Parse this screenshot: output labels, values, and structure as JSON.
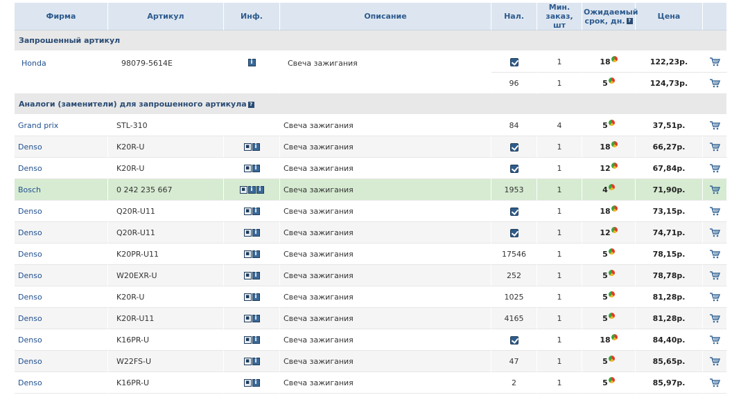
{
  "header": {
    "firm": "Фирма",
    "article": "Артикул",
    "info": "Инф.",
    "description": "Описание",
    "stock": "Нал.",
    "min_order_1": "Мин.",
    "min_order_2": "заказ, шт",
    "eta_1": "Ожидаемый",
    "eta_2": "срок, дн.",
    "price": "Цена"
  },
  "section_requested": "Запрошенный артикул",
  "section_analogs": "Аналоги (заменители) для запрошенного артикула",
  "requested": {
    "firm": "Honda",
    "article": "98079-5614E",
    "description": "Свеча зажигания",
    "offers": [
      {
        "stock": "check",
        "min": "1",
        "eta": "18",
        "price": "122,23р."
      },
      {
        "stock": "96",
        "min": "1",
        "eta": "5",
        "price": "124,73р."
      }
    ]
  },
  "analogs": [
    {
      "firm": "Grand prix",
      "article": "STL-310",
      "info": "",
      "description": "Свеча зажигания",
      "stock": "84",
      "min": "4",
      "eta": "5",
      "price": "37,51р."
    },
    {
      "firm": "Denso",
      "article": "K20R-U",
      "info": "pi",
      "description": "Свеча зажигания",
      "stock": "check",
      "min": "1",
      "eta": "18",
      "price": "66,27р."
    },
    {
      "firm": "Denso",
      "article": "K20R-U",
      "info": "pi",
      "description": "Свеча зажигания",
      "stock": "check",
      "min": "1",
      "eta": "12",
      "price": "67,84р."
    },
    {
      "firm": "Bosch",
      "article": "0 242 235 667",
      "info": "pii",
      "description": "Свеча зажигания",
      "stock": "1953",
      "min": "1",
      "eta": "4",
      "price": "71,90р."
    },
    {
      "firm": "Denso",
      "article": "Q20R-U11",
      "info": "pi",
      "description": "Свеча зажигания",
      "stock": "check",
      "min": "1",
      "eta": "18",
      "price": "73,15р."
    },
    {
      "firm": "Denso",
      "article": "Q20R-U11",
      "info": "pi",
      "description": "Свеча зажигания",
      "stock": "check",
      "min": "1",
      "eta": "12",
      "price": "74,71р."
    },
    {
      "firm": "Denso",
      "article": "K20PR-U11",
      "info": "pi",
      "description": "Свеча зажигания",
      "stock": "17546",
      "min": "1",
      "eta": "5",
      "price": "78,15р."
    },
    {
      "firm": "Denso",
      "article": "W20EXR-U",
      "info": "pi",
      "description": "Свеча зажигания",
      "stock": "252",
      "min": "1",
      "eta": "5",
      "price": "78,78р."
    },
    {
      "firm": "Denso",
      "article": "K20R-U",
      "info": "pi",
      "description": "Свеча зажигания",
      "stock": "1025",
      "min": "1",
      "eta": "5",
      "price": "81,28р."
    },
    {
      "firm": "Denso",
      "article": "K20R-U11",
      "info": "pi",
      "description": "Свеча зажигания",
      "stock": "4165",
      "min": "1",
      "eta": "5",
      "price": "81,28р."
    },
    {
      "firm": "Denso",
      "article": "K16PR-U",
      "info": "pi",
      "description": "Свеча зажигания",
      "stock": "check",
      "min": "1",
      "eta": "18",
      "price": "84,40р."
    },
    {
      "firm": "Denso",
      "article": "W22FS-U",
      "info": "pi",
      "description": "Свеча зажигания",
      "stock": "47",
      "min": "1",
      "eta": "5",
      "price": "85,65р."
    },
    {
      "firm": "Denso",
      "article": "K16PR-U",
      "info": "pi",
      "description": "Свеча зажигания",
      "stock": "2",
      "min": "1",
      "eta": "5",
      "price": "85,97р."
    }
  ],
  "highlighted_analog_index": 3,
  "colors": {
    "header_bg": "#dde6f0",
    "header_text": "#2d5a8e",
    "section_bg": "#e8e8e8",
    "highlight_row": "#d6ebd1",
    "link": "#1f4f8f"
  }
}
